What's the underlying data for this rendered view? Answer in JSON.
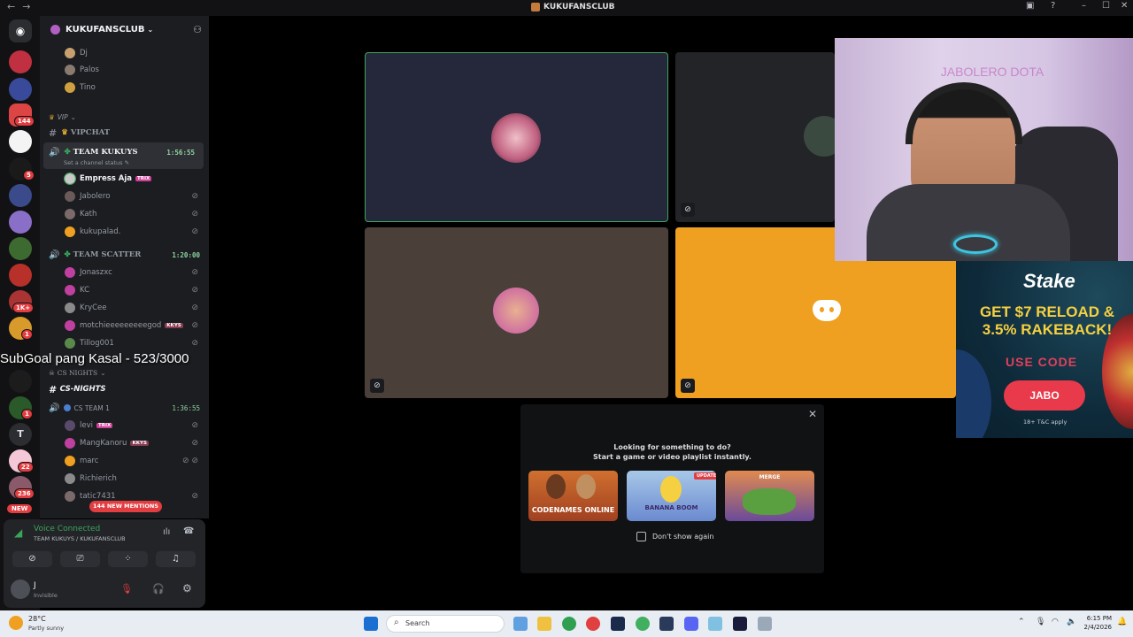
{
  "window": {
    "title": "KUKUFANSCLUB"
  },
  "server": {
    "name": "KUKUFANSCLUB"
  },
  "rail_badges": [
    "144",
    "5",
    "1K+",
    "1",
    "1",
    "22",
    "236",
    "NEW"
  ],
  "channels": {
    "top_users": [
      "Dj",
      "Palos",
      "Tino"
    ],
    "vip_category": "VIP",
    "vipchat": "VIPCHAT",
    "team_kukuys": {
      "name": "TEAM KUKUYS",
      "timer": "1:56:55",
      "status": "Set a channel status",
      "members": [
        {
          "name": "Empress Aja",
          "tag": "TRIX"
        },
        {
          "name": "Jabolero",
          "tag": ""
        },
        {
          "name": "Kath",
          "tag": ""
        },
        {
          "name": "kukupalad.",
          "tag": ""
        }
      ]
    },
    "team_scatter": {
      "name": "TEAM SCATTER",
      "timer": "1:20:00",
      "members": [
        {
          "name": "Jonaszxc",
          "tag": ""
        },
        {
          "name": "KC",
          "tag": ""
        },
        {
          "name": "KryCee",
          "tag": ""
        },
        {
          "name": "motchieeeeeeeeegod",
          "tag": "KKYS"
        },
        {
          "name": "Tillog001",
          "tag": ""
        }
      ]
    },
    "cs_nights_category": "CS NIGHTS",
    "cs_nights_channel": "CS-NIGHTS",
    "cs_team": {
      "name": "CS TEAM 1",
      "timer": "1:36:55",
      "members": [
        {
          "name": "levi",
          "tag": "TRIX"
        },
        {
          "name": "MangKanoru",
          "tag": "KKYS"
        },
        {
          "name": "marc",
          "tag": ""
        },
        {
          "name": "Richierich",
          "tag": ""
        },
        {
          "name": "tatic7431",
          "tag": ""
        }
      ]
    },
    "new_mentions": "144 NEW MENTIONS"
  },
  "voice": {
    "status": "Voice Connected",
    "location": "TEAM KUKUYS / KUKUFANSCLUB"
  },
  "user": {
    "name": "J",
    "status": "Invisible"
  },
  "overlay": {
    "subgoal": "SubGoal pang Kasal - 523/3000"
  },
  "ad": {
    "brand": "Stake",
    "headline": "GET $7 RELOAD & 3.5% RAKEBACK!",
    "code_label": "USE CODE",
    "code": "JABO",
    "fine_print": "18+ T&C apply"
  },
  "webcam_sign": "JABOLERO DOTA",
  "popup": {
    "line1": "Looking for something to do?",
    "line2": "Start a game or video playlist instantly.",
    "games": [
      "CODENAMES ONLINE",
      "BANANA BOOM",
      "MERGE"
    ],
    "update_badge": "UPDATE",
    "checkbox_label": "Don't show again"
  },
  "taskbar": {
    "temp": "28°C",
    "weather": "Partly sunny",
    "search_placeholder": "Search",
    "time": "6:15 PM",
    "date": "2/4/2026"
  },
  "colors": {
    "discord_blurple": "#5865f2",
    "speaking_green": "#3ba55c",
    "tile_orange": "#f0a020",
    "mention_red": "#e23d41"
  }
}
